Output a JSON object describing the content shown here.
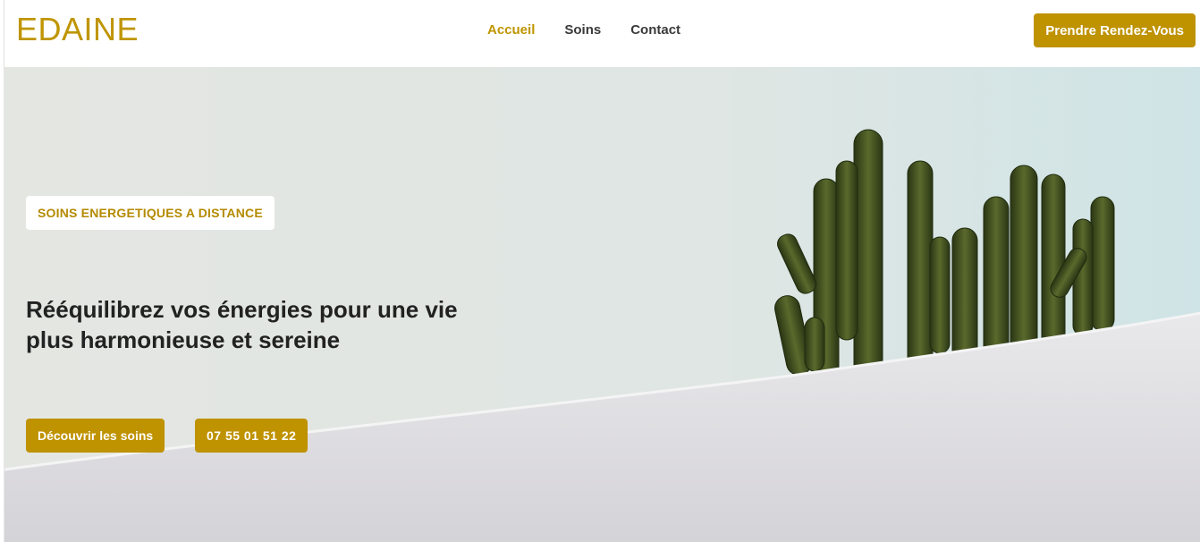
{
  "brand": {
    "name": "EDAINE",
    "accent": "#bf9500"
  },
  "nav": {
    "items": [
      {
        "label": "Accueil",
        "active": true
      },
      {
        "label": "Soins",
        "active": false
      },
      {
        "label": "Contact",
        "active": false
      }
    ]
  },
  "header": {
    "cta_label": "Prendre Rendez-Vous"
  },
  "hero": {
    "tag": "SOINS ENERGETIQUES A DISTANCE",
    "headline_line1": "Rééquilibrez vos énergies pour une vie",
    "headline_line2": "plus harmonieuse et sereine",
    "primary_cta": "Découvrir les soins",
    "phone_cta": "07 55 01 51 22",
    "image": "cactus-on-white-wall"
  }
}
